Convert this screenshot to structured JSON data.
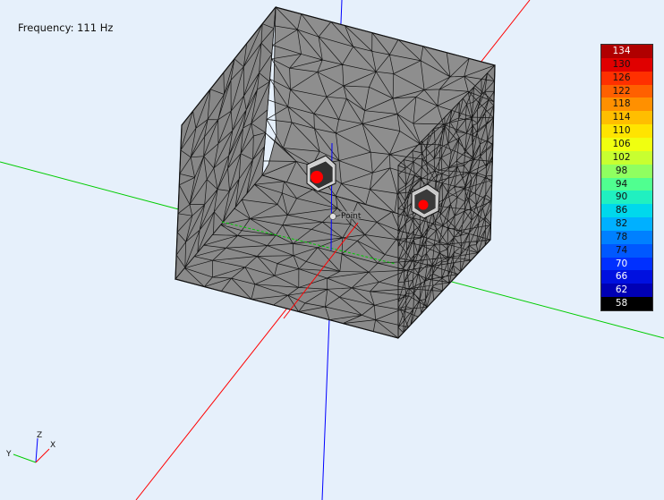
{
  "viewer": {
    "frequency_label": "Frequency: 111 Hz",
    "probe_label": "Point",
    "axis_triad": {
      "z": "Z",
      "y": "Y",
      "x": "X"
    }
  },
  "colorbar": {
    "labels": [
      "134",
      "130",
      "126",
      "122",
      "118",
      "114",
      "110",
      "106",
      "102",
      "98",
      "94",
      "90",
      "86",
      "82",
      "78",
      "74",
      "70",
      "66",
      "62",
      "58"
    ],
    "colors": [
      "#b00000",
      "#e00000",
      "#ff3000",
      "#ff6000",
      "#ff9000",
      "#ffbe00",
      "#ffe400",
      "#f0ff10",
      "#c8ff30",
      "#90ff60",
      "#50ff90",
      "#20f0c0",
      "#00d8ec",
      "#00b0ff",
      "#0080ff",
      "#0058ff",
      "#0030ff",
      "#0010e0",
      "#0000b4",
      "#000000"
    ]
  },
  "scene": {
    "axis_colors": {
      "x": "#ff0000",
      "y": "#00cc00",
      "z": "#0000ff"
    },
    "mesh_fill": "#8c8c8c",
    "source_color": "#ff0000"
  }
}
